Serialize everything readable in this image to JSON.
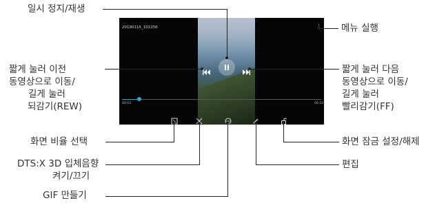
{
  "screen": {
    "filename": "20190115_102256",
    "time_current": "00:03",
    "time_total": "00:33",
    "progress_percent": 9,
    "accent_color": "#3aa1c9",
    "icons": [
      "more-vert-icon",
      "rewind-icon",
      "pause-icon",
      "fast-forward-icon",
      "aspect-ratio-icon",
      "dts-icon",
      "gif-icon",
      "edit-icon",
      "lock-icon"
    ]
  },
  "callouts": {
    "pause_play": "일시 정지/재생",
    "menu": "메뉴 실행",
    "rewind": [
      "짧게 눌러 이전",
      "동영상으로 이동/",
      "길게 눌러",
      "되감기(REW)"
    ],
    "forward": [
      "짧게 눌러 다음",
      "동영상으로 이동/",
      "길게 눌러",
      "빨리감기(FF)"
    ],
    "aspect": "화면 비율 선택",
    "dts": [
      "DTS:X 3D 입체음향",
      "켜기/끄기"
    ],
    "gif": "GIF 만들기",
    "lock": "화면 잠금 설정/해제",
    "edit": "편집"
  }
}
